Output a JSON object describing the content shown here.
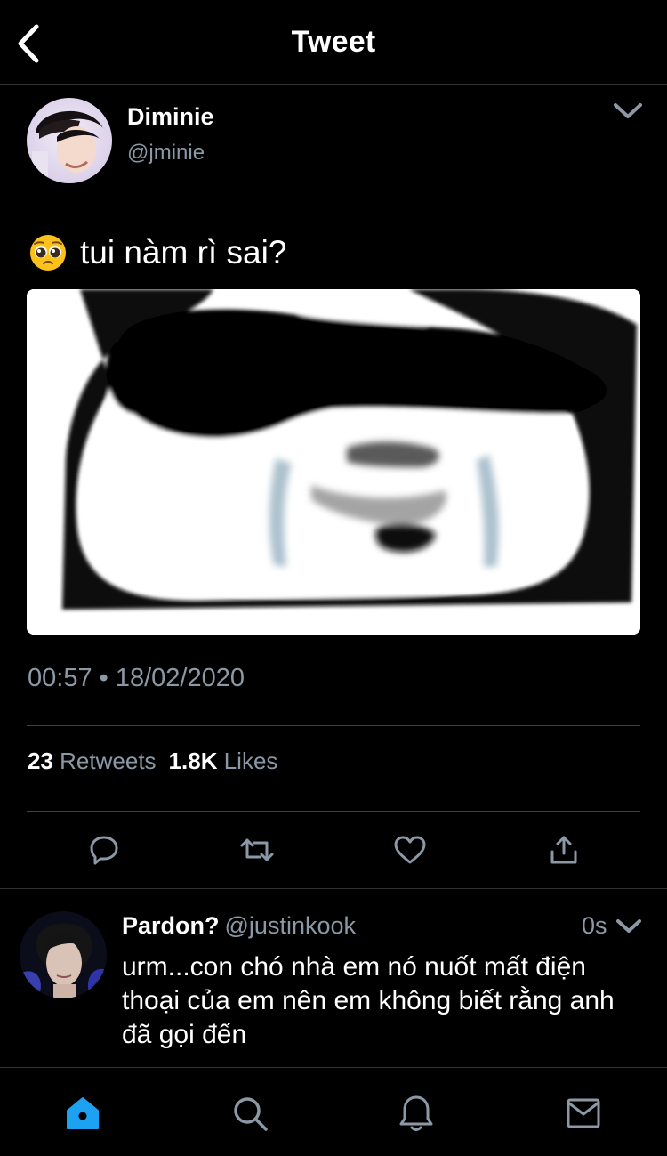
{
  "header": {
    "title": "Tweet",
    "back_icon": "chevron-left-icon"
  },
  "tweet": {
    "author_name": "Diminie",
    "author_handle": "@jminie",
    "emoji": "pleading-face-emoji",
    "text": "tui nàm rì sai?",
    "timestamp": "00:57 • 18/02/2020",
    "retweets_count": "23",
    "retweets_label": "Retweets",
    "likes_count": "1.8K",
    "likes_label": "Likes",
    "actions": [
      "reply-icon",
      "retweet-icon",
      "like-icon",
      "share-icon"
    ]
  },
  "reply": {
    "author_name": "Pardon?",
    "author_handle": "@justinkook",
    "time": "0s",
    "text": "urm...con chó nhà em nó nuốt mất điện thoại của em nên em không biết rằng anh đã gọi đến"
  },
  "bottom_nav": {
    "items": [
      "home-icon",
      "search-icon",
      "notifications-icon",
      "messages-icon"
    ],
    "active": "home-icon",
    "accent_color": "#1da1f2"
  },
  "colors": {
    "background": "#000000",
    "secondary_text": "#8b98a5",
    "divider": "#2f3336"
  }
}
